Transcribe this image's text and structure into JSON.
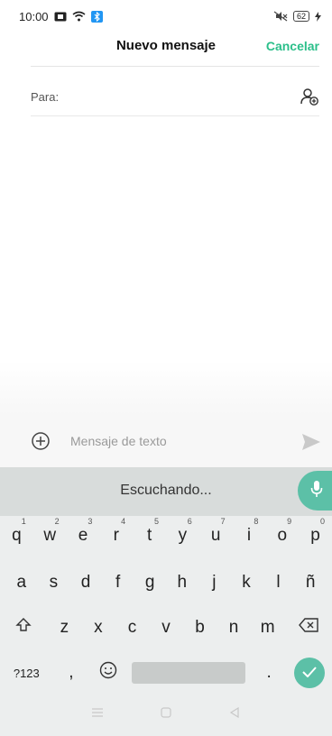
{
  "status_bar": {
    "time": "10:00",
    "battery_level": "62",
    "icons": [
      "notification-icon",
      "wifi-icon",
      "bluetooth-icon",
      "mute-icon",
      "battery-icon",
      "charging-icon"
    ]
  },
  "header": {
    "title": "Nuevo mensaje",
    "cancel_label": "Cancelar"
  },
  "recipient": {
    "label": "Para:",
    "value": "",
    "icon": "add-contact-icon"
  },
  "compose": {
    "placeholder": "Mensaje de texto",
    "add_icon": "plus-circle-icon",
    "send_icon": "send-icon"
  },
  "keyboard": {
    "status_text": "Escuchando...",
    "row1": [
      {
        "key": "q",
        "hint": "1"
      },
      {
        "key": "w",
        "hint": "2"
      },
      {
        "key": "e",
        "hint": "3"
      },
      {
        "key": "r",
        "hint": "4"
      },
      {
        "key": "t",
        "hint": "5"
      },
      {
        "key": "y",
        "hint": "6"
      },
      {
        "key": "u",
        "hint": "7"
      },
      {
        "key": "i",
        "hint": "8"
      },
      {
        "key": "o",
        "hint": "9"
      },
      {
        "key": "p",
        "hint": "0"
      }
    ],
    "row2": [
      "a",
      "s",
      "d",
      "f",
      "g",
      "h",
      "j",
      "k",
      "l",
      "ñ"
    ],
    "row3": [
      "z",
      "x",
      "c",
      "v",
      "b",
      "n",
      "m"
    ],
    "symbols_label": "?123",
    "comma_label": ",",
    "period_label": "."
  },
  "colors": {
    "accent": "#2bbf8a",
    "keyboard_accent": "#5cc0a7",
    "keyboard_bg": "#eceeee"
  }
}
